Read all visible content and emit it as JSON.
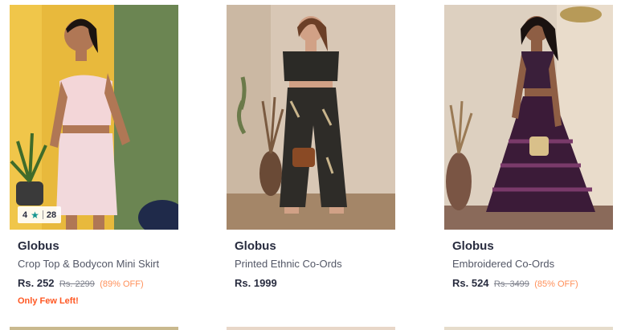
{
  "products": [
    {
      "brand": "Globus",
      "title": "Crop Top & Bodycon Mini Skirt",
      "price": "Rs. 252",
      "mrp": "Rs. 2299",
      "discount": "(89% OFF)",
      "rating": "4",
      "rating_count": "28",
      "stock_note": "Only Few Left!"
    },
    {
      "brand": "Globus",
      "title": "Printed Ethnic Co-Ords",
      "price": "Rs. 1999"
    },
    {
      "brand": "Globus",
      "title": "Embroidered Co-Ords",
      "price": "Rs. 524",
      "mrp": "Rs. 3499",
      "discount": "(85% OFF)"
    }
  ],
  "icons": {
    "rating_star": "star-icon"
  },
  "colors": {
    "discount": "#ff905a",
    "stock_note": "#ff5722",
    "rating_star": "#14958f"
  }
}
